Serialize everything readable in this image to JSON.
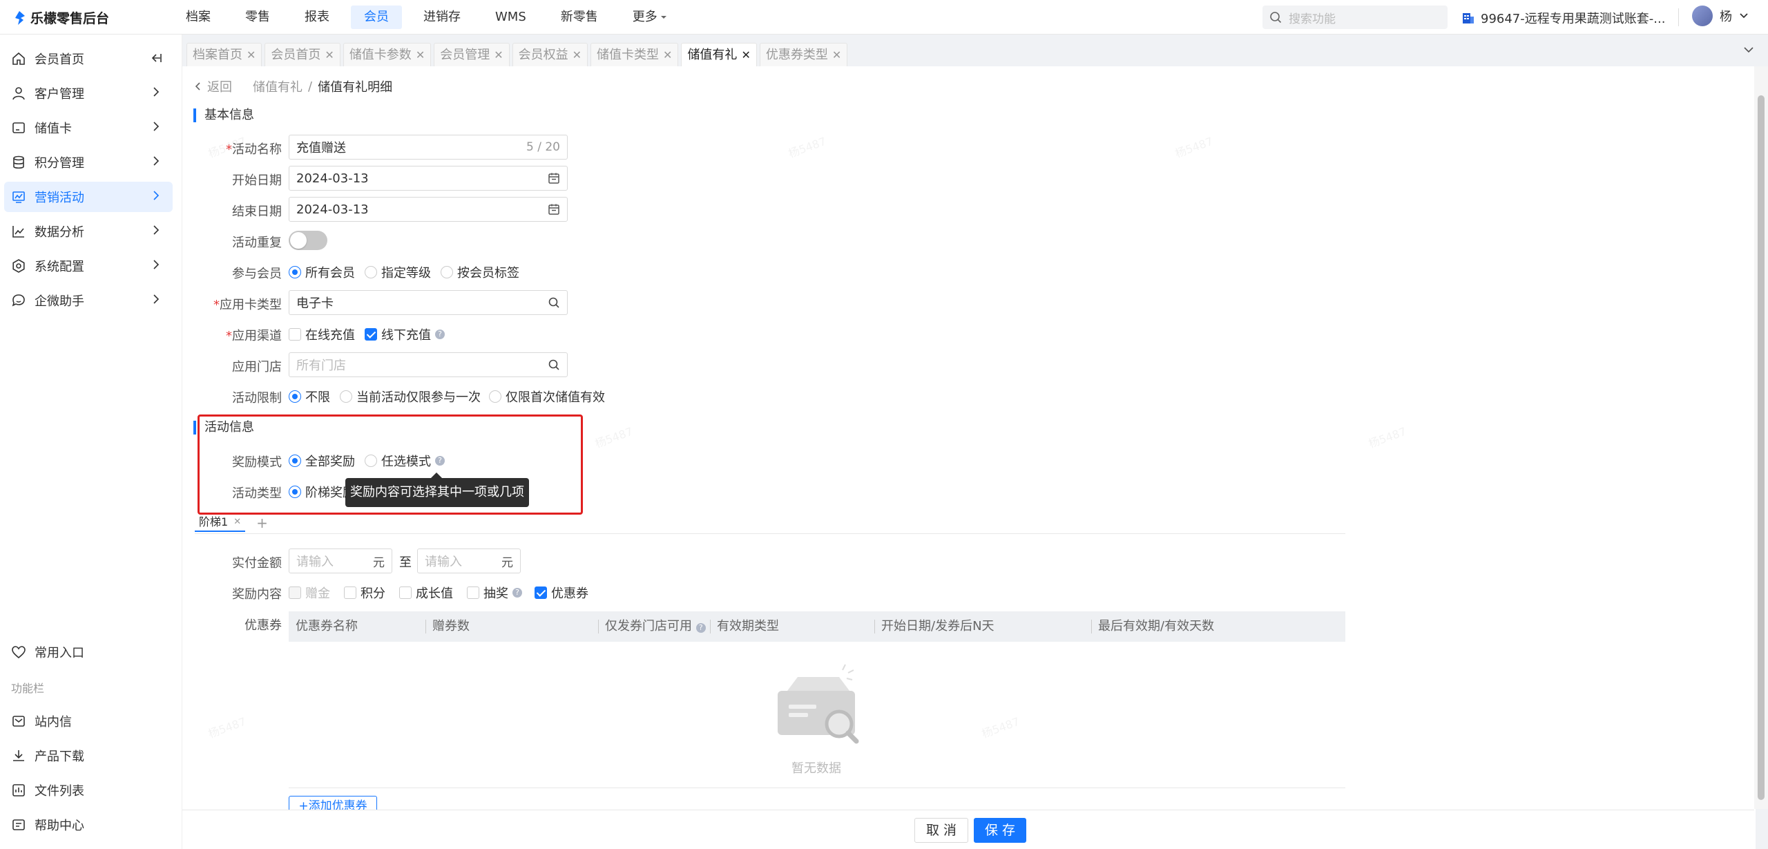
{
  "app": {
    "name": "乐檬零售后台"
  },
  "topnav": [
    "档案",
    "零售",
    "报表",
    "会员",
    "进销存",
    "WMS",
    "新零售",
    "更多"
  ],
  "topnav_active": "会员",
  "search": {
    "placeholder": "搜索功能"
  },
  "store": {
    "name": "99647-远程专用果蔬测试账套-..."
  },
  "user": {
    "name": "杨"
  },
  "sidebar": {
    "items": [
      {
        "label": "会员首页",
        "icon": "home-icon"
      },
      {
        "label": "客户管理",
        "icon": "user-icon"
      },
      {
        "label": "储值卡",
        "icon": "card-icon"
      },
      {
        "label": "积分管理",
        "icon": "database-icon"
      },
      {
        "label": "营销活动",
        "icon": "monitor-icon"
      },
      {
        "label": "数据分析",
        "icon": "chart-icon"
      },
      {
        "label": "系统配置",
        "icon": "settings-icon"
      },
      {
        "label": "企微助手",
        "icon": "chat-icon"
      }
    ],
    "favorites": "常用入口",
    "section": "功能栏",
    "bottom": [
      {
        "label": "站内信",
        "icon": "mail-icon"
      },
      {
        "label": "产品下载",
        "icon": "download-icon"
      },
      {
        "label": "文件列表",
        "icon": "file-list-icon"
      },
      {
        "label": "帮助中心",
        "icon": "help-center-icon"
      }
    ]
  },
  "tabs": [
    "档案首页",
    "会员首页",
    "储值卡参数",
    "会员管理",
    "会员权益",
    "储值卡类型",
    "储值有礼",
    "优惠券类型"
  ],
  "active_tab": "储值有礼",
  "breadcrumb": {
    "back": "返回",
    "parent": "储值有礼",
    "separator": "/",
    "current": "储值有礼明细"
  },
  "basic": {
    "title": "基本信息",
    "name_label": "活动名称",
    "name_value": "充值赠送",
    "name_count": "5 / 20",
    "start_label": "开始日期",
    "start_value": "2024-03-13",
    "end_label": "结束日期",
    "end_value": "2024-03-13",
    "repeat_label": "活动重复",
    "members_label": "参与会员",
    "members_options": [
      "所有会员",
      "指定等级",
      "按会员标签"
    ],
    "cardtype_label": "应用卡类型",
    "cardtype_value": "电子卡",
    "channel_label": "应用渠道",
    "channel_options": [
      "在线充值",
      "线下充值"
    ],
    "store_label": "应用门店",
    "store_placeholder": "所有门店",
    "limit_label": "活动限制",
    "limit_options": [
      "不限",
      "当前活动仅限参与一次",
      "仅限首次储值有效"
    ]
  },
  "activity": {
    "title": "活动信息",
    "reward_mode_label": "奖励模式",
    "reward_mode_options": [
      "全部奖励",
      "任选模式"
    ],
    "type_label": "活动类型",
    "type_value": "阶梯奖励",
    "tooltip": "奖励内容可选择其中一项或几项"
  },
  "tier": {
    "tab": "阶梯1",
    "add": "+"
  },
  "amount": {
    "label": "实付金额",
    "placeholder": "请输入",
    "unit": "元",
    "to": "至"
  },
  "reward_content": {
    "label": "奖励内容",
    "options": [
      "赠金",
      "积分",
      "成长值",
      "抽奖",
      "优惠券"
    ]
  },
  "coupon": {
    "label": "优惠券",
    "columns": [
      "优惠券名称",
      "赠券数",
      "仅发券门店可用",
      "有效期类型",
      "开始日期/发券后N天",
      "最后有效期/有效天数"
    ],
    "empty": "暂无数据",
    "add_button": "+添加优惠券"
  },
  "footer": {
    "cancel": "取 消",
    "save": "保 存"
  },
  "watermark": "杨5487",
  "colors": {
    "primary": "#1677ff",
    "highlight_box": "#e02020",
    "required": "#e63c3c"
  }
}
